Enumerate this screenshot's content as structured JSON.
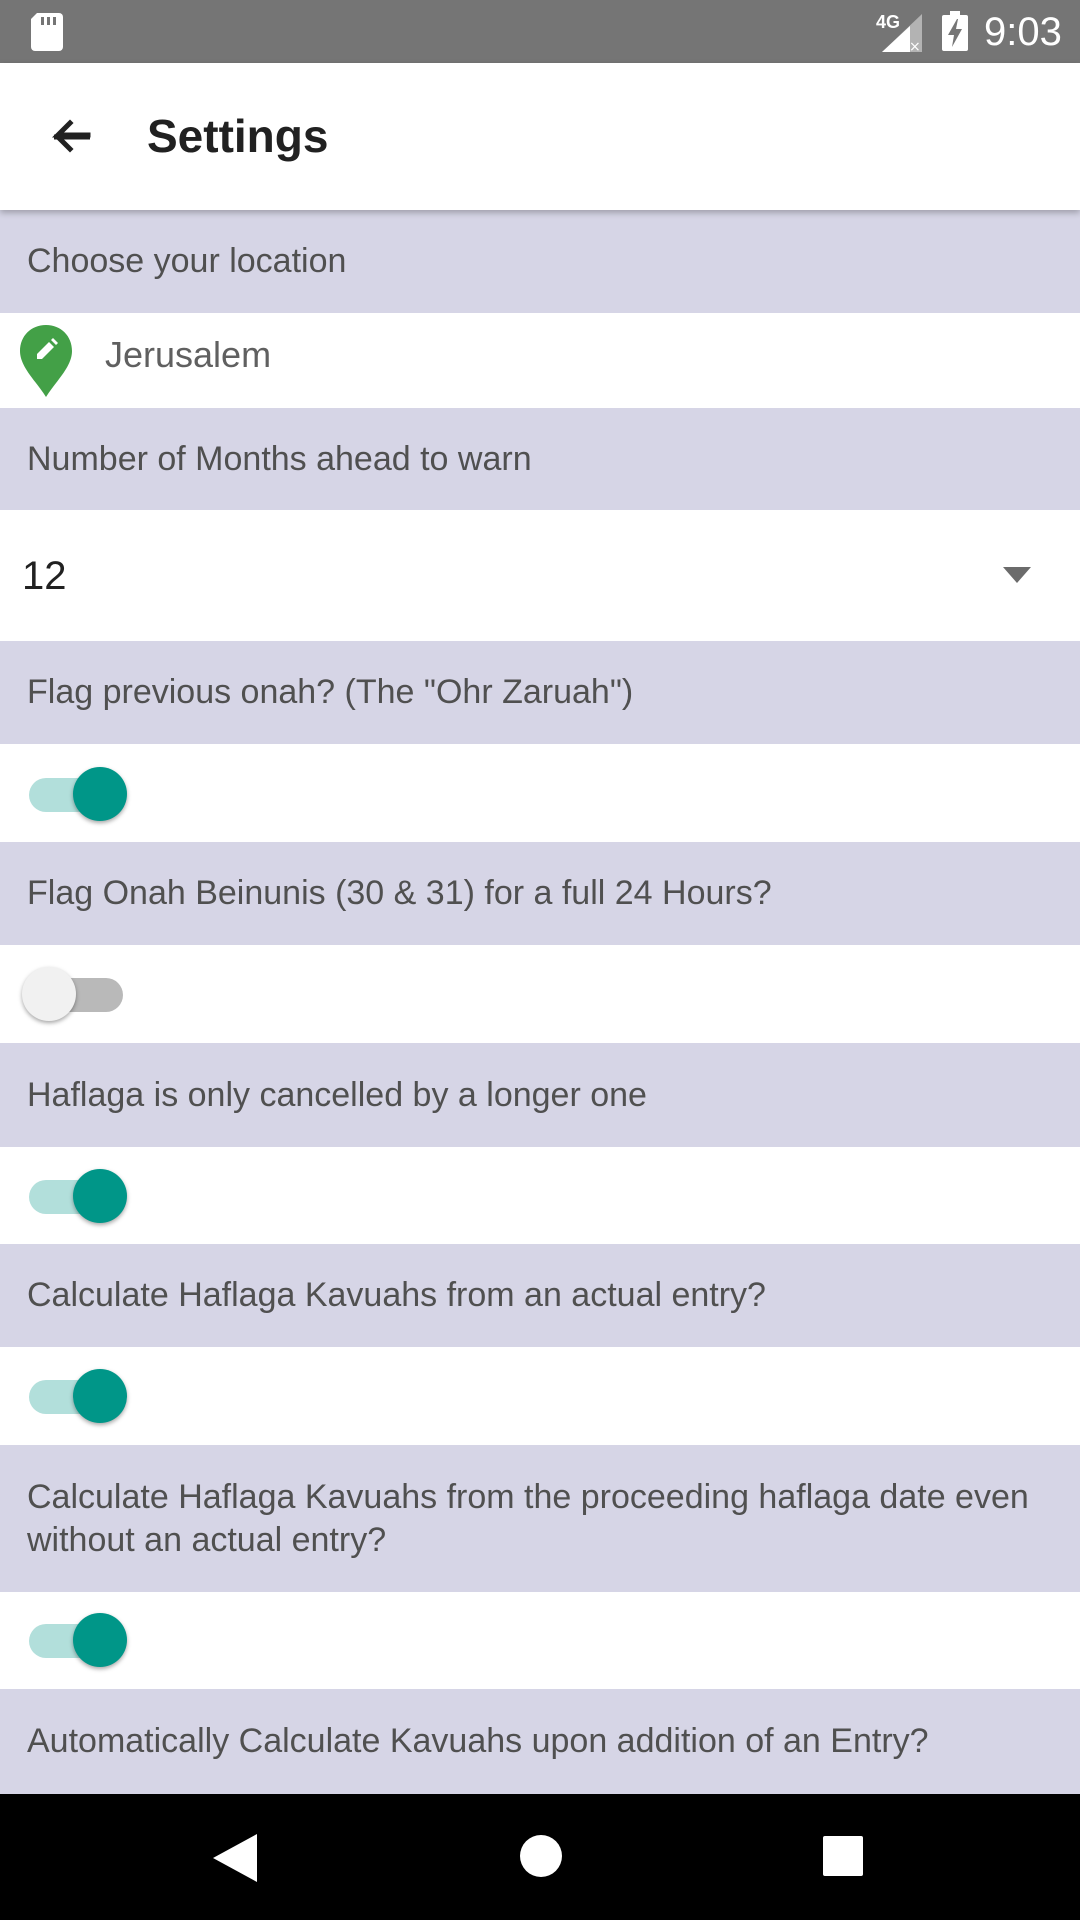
{
  "status_bar": {
    "network": "4G",
    "time": "9:03",
    "icons": [
      "sd-card-icon",
      "signal-icon",
      "battery-charging-icon"
    ]
  },
  "app_bar": {
    "title": "Settings",
    "back_icon": "arrow-back-icon"
  },
  "settings": {
    "location": {
      "header": "Choose your location",
      "value": "Jerusalem",
      "icon": "location-pin-edit-icon",
      "icon_color": "#43a047"
    },
    "months_ahead": {
      "header": "Number of Months ahead to warn",
      "value": "12"
    },
    "ohr_zaruah": {
      "header": "Flag previous onah? (The \"Ohr Zaruah\")",
      "enabled": true
    },
    "onah_beinunis_24": {
      "header": "Flag Onah Beinunis (30 & 31) for a full 24 Hours?",
      "enabled": false
    },
    "haflaga_cancel": {
      "header": "Haflaga is only cancelled by a longer one",
      "enabled": true
    },
    "haflaga_actual_entry": {
      "header": "Calculate Haflaga Kavuahs from an actual entry?",
      "enabled": true
    },
    "haflaga_proceeding": {
      "header": "Calculate Haflaga Kavuahs from the proceeding haflaga date even without an actual entry?",
      "enabled": true
    },
    "auto_kavuahs": {
      "header": "Automatically Calculate Kavuahs upon addition of an Entry?"
    }
  },
  "colors": {
    "section_header_bg": "#d6d5e6",
    "toggle_on": "#009688",
    "toggle_on_track": "#b2dfdb",
    "status_bar_bg": "#757575"
  },
  "nav_bar": {
    "buttons": [
      "nav-back-icon",
      "nav-home-icon",
      "nav-recents-icon"
    ]
  }
}
